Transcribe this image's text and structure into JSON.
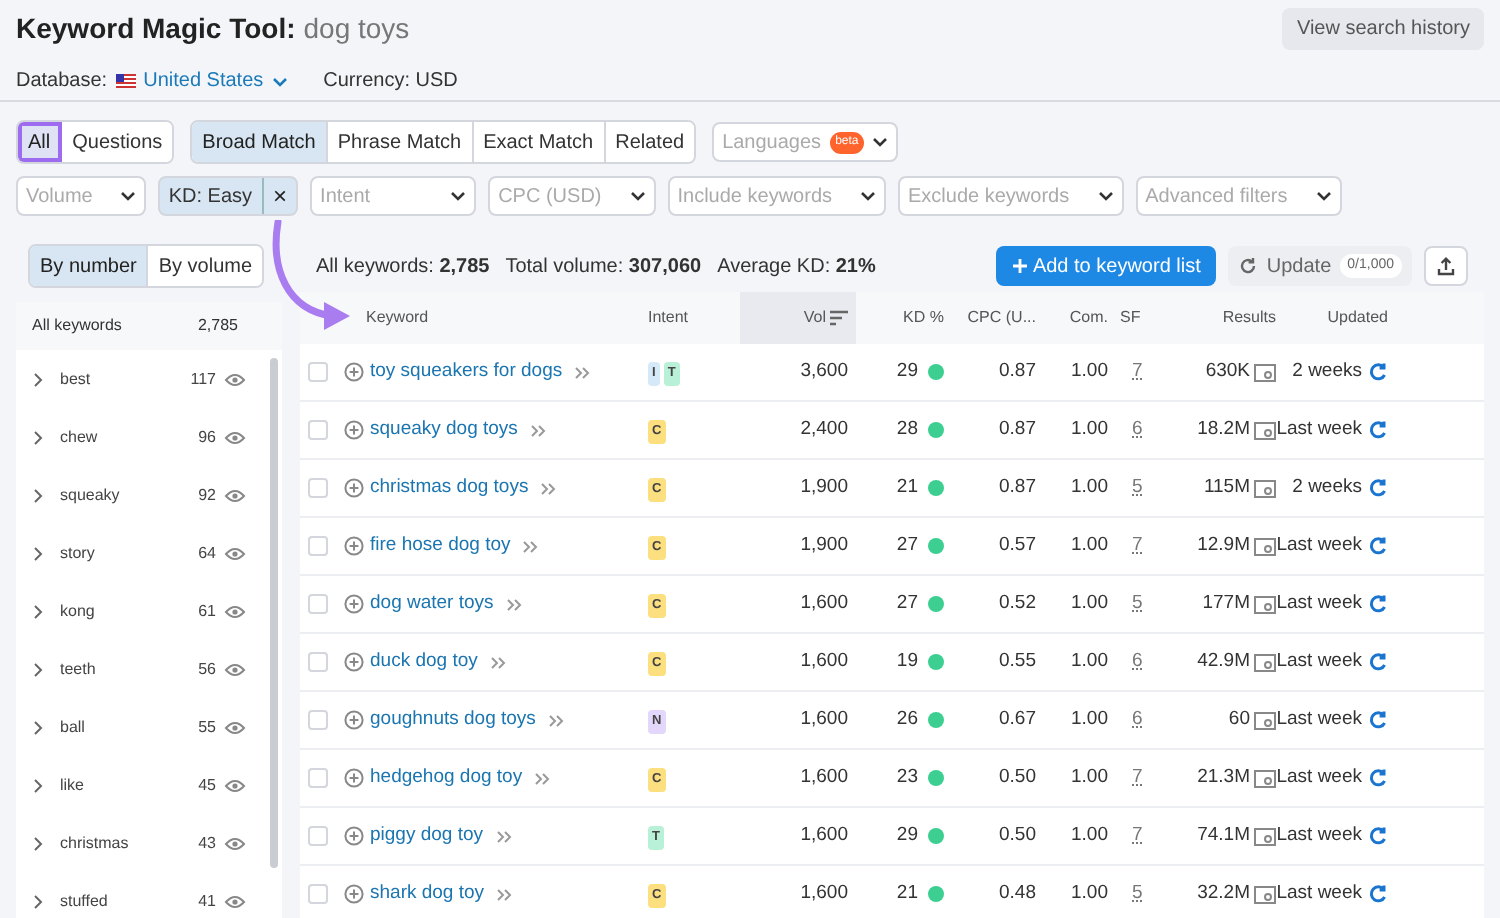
{
  "title": "Keyword Magic Tool:",
  "query": "dog toys",
  "history_button": "View search history",
  "database_label": "Database:",
  "database": "United States",
  "currency": "Currency: USD",
  "type_tabs": [
    {
      "label": "All",
      "selected": true
    },
    {
      "label": "Questions",
      "selected": false
    }
  ],
  "match_tabs": [
    {
      "label": "Broad Match",
      "selected": true
    },
    {
      "label": "Phrase Match",
      "selected": false
    },
    {
      "label": "Exact Match",
      "selected": false
    },
    {
      "label": "Related",
      "selected": false
    }
  ],
  "languages": {
    "label": "Languages",
    "badge": "beta"
  },
  "filters": [
    {
      "label": "Volume",
      "active": false
    },
    {
      "label": "KD: Easy",
      "active": true,
      "clear": "×"
    },
    {
      "label": "Intent",
      "active": false
    },
    {
      "label": "CPC (USD)",
      "active": false
    },
    {
      "label": "Include keywords",
      "active": false
    },
    {
      "label": "Exclude keywords",
      "active": false
    },
    {
      "label": "Advanced filters",
      "active": false
    }
  ],
  "group_tabs": [
    {
      "label": "By number",
      "selected": true
    },
    {
      "label": "By volume",
      "selected": false
    }
  ],
  "summary": [
    {
      "label": "All keywords:",
      "value": "2,785"
    },
    {
      "label": "Total volume:",
      "value": "307,060"
    },
    {
      "label": "Average KD:",
      "value": "21%"
    }
  ],
  "add_button": "Add to keyword list",
  "update_button": "Update",
  "update_count": "0/1,000",
  "sidebar": {
    "header": "All keywords",
    "count": "2,785",
    "items": [
      {
        "label": "best",
        "count": "117"
      },
      {
        "label": "chew",
        "count": "96"
      },
      {
        "label": "squeaky",
        "count": "92"
      },
      {
        "label": "story",
        "count": "64"
      },
      {
        "label": "kong",
        "count": "61"
      },
      {
        "label": "teeth",
        "count": "56"
      },
      {
        "label": "ball",
        "count": "55"
      },
      {
        "label": "like",
        "count": "45"
      },
      {
        "label": "christmas",
        "count": "43"
      },
      {
        "label": "stuffed",
        "count": "41"
      }
    ]
  },
  "table": {
    "columns": [
      "Keyword",
      "Intent",
      "Vol",
      "KD %",
      "CPC (U...",
      "Com.",
      "SF",
      "Results",
      "Updated"
    ],
    "rows": [
      {
        "checked": false,
        "keyword": "toy squeakers for dogs",
        "intent": [
          {
            "letter": "I",
            "color": "#d6e9f8"
          },
          {
            "letter": "T",
            "color": "#b9f0d8"
          }
        ],
        "volume": "3,600",
        "kd": "29",
        "cpc": "0.87",
        "com": "1.00",
        "sf": "7",
        "results": "630K",
        "updated": "2 weeks"
      },
      {
        "checked": false,
        "keyword": "squeaky dog toys",
        "intent": [
          {
            "letter": "C",
            "color": "#fcdf7e"
          }
        ],
        "volume": "2,400",
        "kd": "28",
        "cpc": "0.87",
        "com": "1.00",
        "sf": "6",
        "results": "18.2M",
        "updated": "Last week"
      },
      {
        "checked": false,
        "keyword": "christmas dog toys",
        "intent": [
          {
            "letter": "C",
            "color": "#fcdf7e"
          }
        ],
        "volume": "1,900",
        "kd": "21",
        "cpc": "0.87",
        "com": "1.00",
        "sf": "5",
        "results": "115M",
        "updated": "2 weeks"
      },
      {
        "checked": false,
        "keyword": "fire hose dog toy",
        "intent": [
          {
            "letter": "C",
            "color": "#fcdf7e"
          }
        ],
        "volume": "1,900",
        "kd": "27",
        "cpc": "0.57",
        "com": "1.00",
        "sf": "7",
        "results": "12.9M",
        "updated": "Last week"
      },
      {
        "checked": false,
        "keyword": "dog water toys",
        "intent": [
          {
            "letter": "C",
            "color": "#fcdf7e"
          }
        ],
        "volume": "1,600",
        "kd": "27",
        "cpc": "0.52",
        "com": "1.00",
        "sf": "5",
        "results": "177M",
        "updated": "Last week"
      },
      {
        "checked": false,
        "keyword": "duck dog toy",
        "intent": [
          {
            "letter": "C",
            "color": "#fcdf7e"
          }
        ],
        "volume": "1,600",
        "kd": "19",
        "cpc": "0.55",
        "com": "1.00",
        "sf": "6",
        "results": "42.9M",
        "updated": "Last week"
      },
      {
        "checked": false,
        "keyword": "goughnuts dog toys",
        "intent": [
          {
            "letter": "N",
            "color": "#e3d8fb"
          }
        ],
        "volume": "1,600",
        "kd": "26",
        "cpc": "0.67",
        "com": "1.00",
        "sf": "6",
        "results": "60",
        "updated": "Last week"
      },
      {
        "checked": false,
        "keyword": "hedgehog dog toy",
        "intent": [
          {
            "letter": "C",
            "color": "#fcdf7e"
          }
        ],
        "volume": "1,600",
        "kd": "23",
        "cpc": "0.50",
        "com": "1.00",
        "sf": "7",
        "results": "21.3M",
        "updated": "Last week"
      },
      {
        "checked": false,
        "keyword": "piggy dog toy",
        "intent": [
          {
            "letter": "T",
            "color": "#b9f0d8"
          }
        ],
        "volume": "1,600",
        "kd": "29",
        "cpc": "0.50",
        "com": "1.00",
        "sf": "7",
        "results": "74.1M",
        "updated": "Last week"
      },
      {
        "checked": false,
        "keyword": "shark dog toy",
        "intent": [
          {
            "letter": "C",
            "color": "#fcdf7e"
          }
        ],
        "volume": "1,600",
        "kd": "21",
        "cpc": "0.48",
        "com": "1.00",
        "sf": "5",
        "results": "32.2M",
        "updated": "Last week"
      }
    ]
  }
}
